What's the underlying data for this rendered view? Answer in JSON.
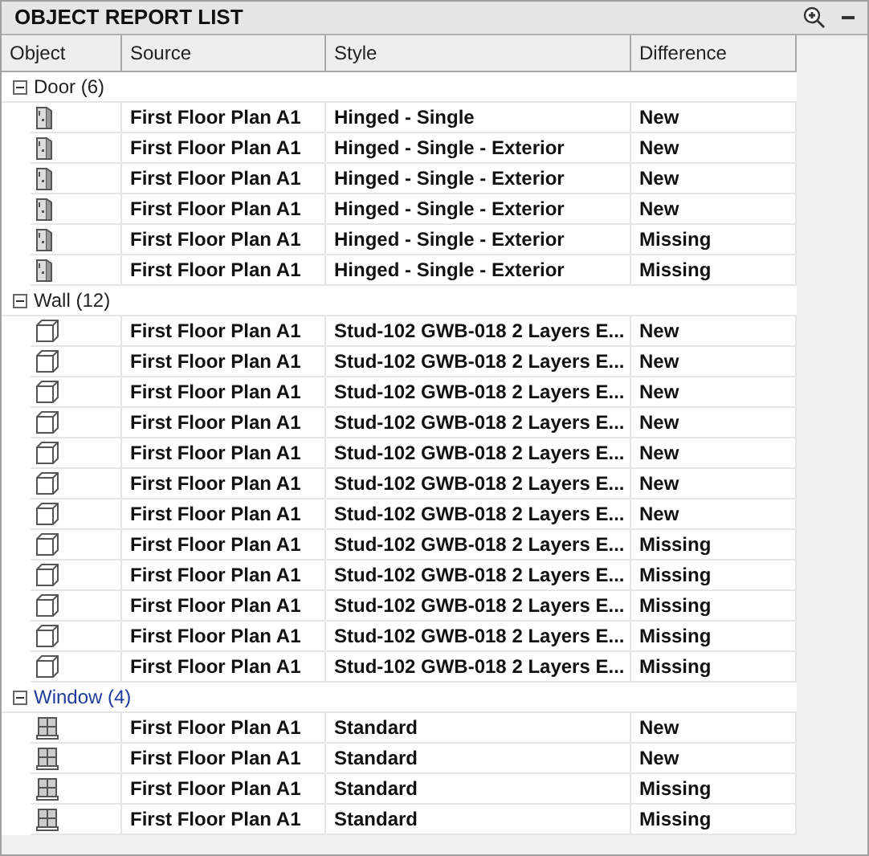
{
  "panel": {
    "title": "OBJECT REPORT LIST"
  },
  "table": {
    "columns": [
      "Object",
      "Source",
      "Style",
      "Difference"
    ],
    "groups": [
      {
        "label": "Door (6)",
        "kind": "door",
        "expanded": true,
        "selected": false,
        "rows": [
          {
            "source": "First Floor Plan A1",
            "style": "Hinged - Single",
            "difference": "New"
          },
          {
            "source": "First Floor Plan A1",
            "style": "Hinged - Single - Exterior",
            "difference": "New"
          },
          {
            "source": "First Floor Plan A1",
            "style": "Hinged - Single - Exterior",
            "difference": "New"
          },
          {
            "source": "First Floor Plan A1",
            "style": "Hinged - Single - Exterior",
            "difference": "New"
          },
          {
            "source": "First Floor Plan A1",
            "style": "Hinged - Single - Exterior",
            "difference": "Missing"
          },
          {
            "source": "First Floor Plan A1",
            "style": "Hinged - Single - Exterior",
            "difference": "Missing"
          }
        ]
      },
      {
        "label": "Wall (12)",
        "kind": "wall",
        "expanded": true,
        "selected": false,
        "rows": [
          {
            "source": "First Floor Plan A1",
            "style": "Stud-102 GWB-018 2 Layers E...",
            "difference": "New"
          },
          {
            "source": "First Floor Plan A1",
            "style": "Stud-102 GWB-018 2 Layers E...",
            "difference": "New"
          },
          {
            "source": "First Floor Plan A1",
            "style": "Stud-102 GWB-018 2 Layers E...",
            "difference": "New"
          },
          {
            "source": "First Floor Plan A1",
            "style": "Stud-102 GWB-018 2 Layers E...",
            "difference": "New"
          },
          {
            "source": "First Floor Plan A1",
            "style": "Stud-102 GWB-018 2 Layers E...",
            "difference": "New"
          },
          {
            "source": "First Floor Plan A1",
            "style": "Stud-102 GWB-018 2 Layers E...",
            "difference": "New"
          },
          {
            "source": "First Floor Plan A1",
            "style": "Stud-102 GWB-018 2 Layers E...",
            "difference": "New"
          },
          {
            "source": "First Floor Plan A1",
            "style": "Stud-102 GWB-018 2 Layers E...",
            "difference": "Missing"
          },
          {
            "source": "First Floor Plan A1",
            "style": "Stud-102 GWB-018 2 Layers E...",
            "difference": "Missing"
          },
          {
            "source": "First Floor Plan A1",
            "style": "Stud-102 GWB-018 2 Layers E...",
            "difference": "Missing"
          },
          {
            "source": "First Floor Plan A1",
            "style": "Stud-102 GWB-018 2 Layers E...",
            "difference": "Missing"
          },
          {
            "source": "First Floor Plan A1",
            "style": "Stud-102 GWB-018 2 Layers E...",
            "difference": "Missing"
          }
        ]
      },
      {
        "label": "Window (4)",
        "kind": "window",
        "expanded": true,
        "selected": true,
        "rows": [
          {
            "source": "First Floor Plan A1",
            "style": "Standard",
            "difference": "New"
          },
          {
            "source": "First Floor Plan A1",
            "style": "Standard",
            "difference": "New"
          },
          {
            "source": "First Floor Plan A1",
            "style": "Standard",
            "difference": "Missing"
          },
          {
            "source": "First Floor Plan A1",
            "style": "Standard",
            "difference": "Missing"
          }
        ]
      }
    ]
  }
}
